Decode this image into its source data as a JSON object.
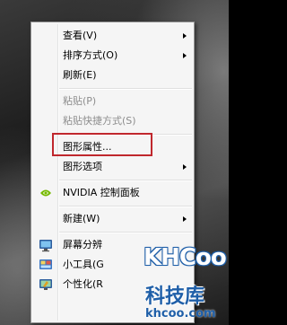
{
  "context_menu": {
    "items": [
      {
        "label": "查看(V)"
      },
      {
        "label": "排序方式(O)"
      },
      {
        "label": "刷新(E)"
      },
      {
        "label": "粘贴(P)"
      },
      {
        "label": "粘贴快捷方式(S)"
      },
      {
        "label": "图形属性..."
      },
      {
        "label": "图形选项"
      },
      {
        "label": "NVIDIA 控制面板"
      },
      {
        "label": "新建(W)"
      },
      {
        "label": "屏幕分辨"
      },
      {
        "label": "小工具(G"
      },
      {
        "label": "个性化(R"
      }
    ],
    "highlighted_item": "图形属性...",
    "highlight_color": "#c0272d"
  },
  "watermark": {
    "logo": "KHCoo",
    "title": "科技库",
    "url": "khcoo.com"
  },
  "colors": {
    "menu_bg": "#f5f5f5",
    "disabled_text": "#8d8d8d",
    "nvidia_green": "#76b900",
    "watermark_blue": "#1f5fa8"
  }
}
